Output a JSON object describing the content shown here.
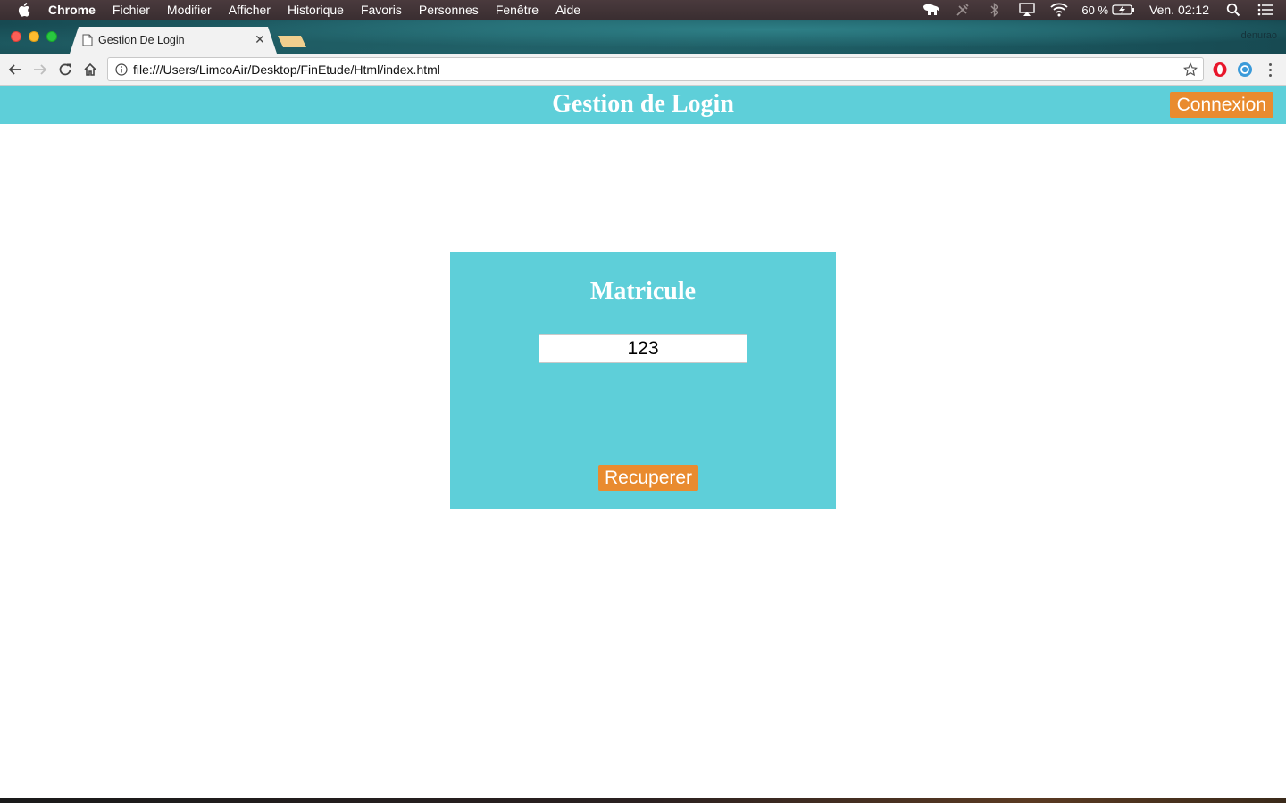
{
  "menubar": {
    "app_name": "Chrome",
    "items": [
      "Fichier",
      "Modifier",
      "Afficher",
      "Historique",
      "Favoris",
      "Personnes",
      "Fenêtre",
      "Aide"
    ],
    "battery_text": "60 %",
    "clock": "Ven. 02:12"
  },
  "browser": {
    "tab_title": "Gestion De Login",
    "profile_name": "denurao",
    "url": "file:///Users/LimcoAir/Desktop/FinEtude/Html/index.html"
  },
  "page": {
    "header_title": "Gestion de Login",
    "connexion_label": "Connexion",
    "card_title": "Matricule",
    "matricule_value": "123",
    "recuperer_label": "Recuperer"
  },
  "colors": {
    "header_bg": "#5ecfd9",
    "button_bg": "#e98b2f"
  }
}
